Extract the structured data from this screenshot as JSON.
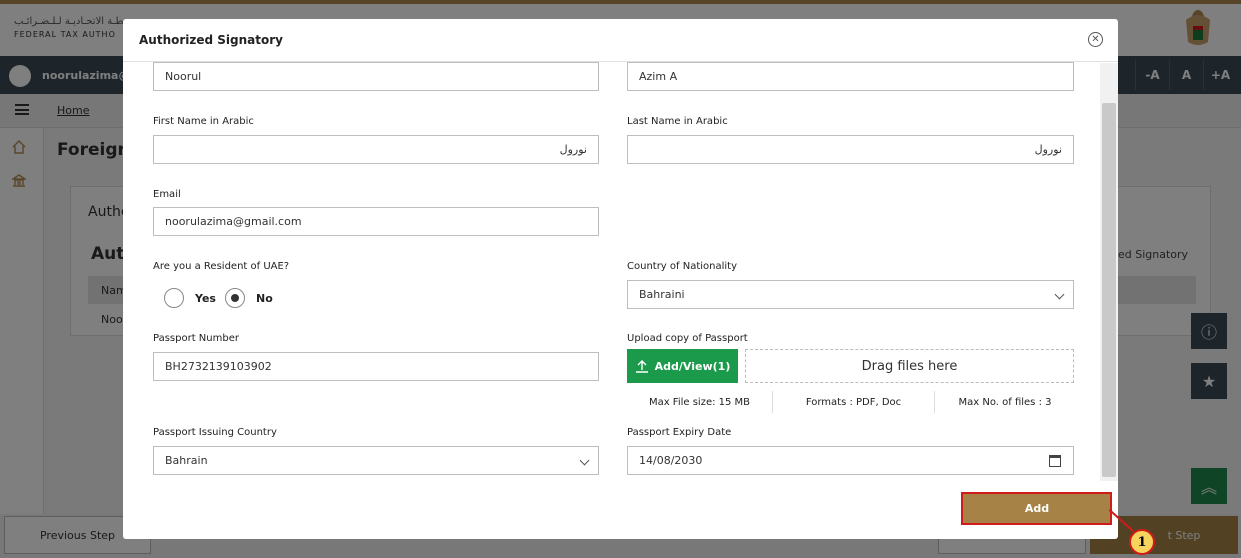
{
  "background": {
    "header": {
      "logo_arabic": "ـطـة الاتحـاديـة لـلـضـرائـب",
      "logo_english": "FEDERAL TAX AUTHO"
    },
    "user_name": "noorulazima@g",
    "font_controls": [
      "-A",
      "A",
      "+A"
    ],
    "breadcrumb_home": "Home",
    "page_title": "Foreign",
    "card_heading": "Authe",
    "card_subheading": "Auth",
    "table_header_name": "Nam",
    "table_row_name": "Noo",
    "authorized_signatory_col": "ed Signatory",
    "footer": {
      "previous": "Previous Step",
      "next": "t Step"
    }
  },
  "modal": {
    "title": "Authorized Signatory",
    "close_icon": "close-circle-icon",
    "fields": {
      "first_name": "Noorul",
      "last_name": "Azim A",
      "first_name_arabic_label": "First Name in Arabic",
      "first_name_arabic": "نورول",
      "last_name_arabic_label": "Last Name in Arabic",
      "last_name_arabic": "نورول",
      "email_label": "Email",
      "email": "noorulazima@gmail.com",
      "resident_label": "Are you a Resident of UAE?",
      "resident_yes": "Yes",
      "resident_no": "No",
      "resident_value": "No",
      "nationality_label": "Country of Nationality",
      "nationality": "Bahraini",
      "passport_number_label": "Passport Number",
      "passport_number": "BH2732139103902",
      "upload_label": "Upload copy of Passport",
      "upload_button": "Add/View(1)",
      "drop_zone": "Drag files here",
      "max_file_size": "Max File size: 15 MB",
      "formats": "Formats : PDF, Doc",
      "max_files": "Max No. of files : 3",
      "issuing_country_label": "Passport Issuing Country",
      "issuing_country": "Bahrain",
      "expiry_label": "Passport Expiry Date",
      "expiry_date": "14/08/2030"
    },
    "add_button": "Add"
  },
  "annotation": {
    "callout_number": "1",
    "color": "#d11a1a"
  },
  "colors": {
    "accent_gold": "#a78246",
    "upload_green": "#1a9a4a",
    "dark_bar": "#3a4a56"
  }
}
